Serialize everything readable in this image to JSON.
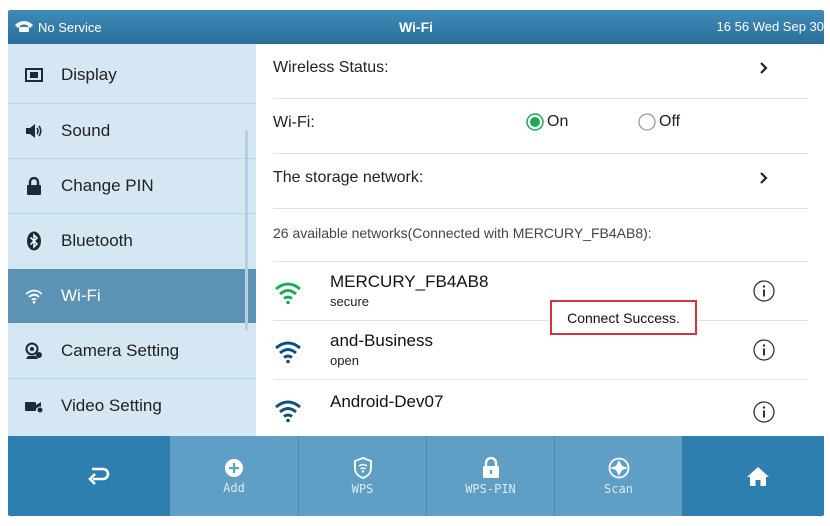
{
  "status_bar": {
    "signal_text": "No Service",
    "title": "Wi-Fi",
    "datetime": "16 56 Wed Sep 30"
  },
  "sidebar": {
    "items": [
      {
        "label": "Display",
        "icon": "display-icon"
      },
      {
        "label": "Sound",
        "icon": "speaker-icon"
      },
      {
        "label": "Change PIN",
        "icon": "lock-icon"
      },
      {
        "label": "Bluetooth",
        "icon": "bluetooth-icon"
      },
      {
        "label": "Wi-Fi",
        "icon": "wifi-icon",
        "active": true
      },
      {
        "label": "Camera Setting",
        "icon": "camera-icon"
      },
      {
        "label": "Video Setting",
        "icon": "video-icon"
      }
    ]
  },
  "main": {
    "wireless_status_label": "Wireless Status:",
    "wifi_label": "Wi-Fi:",
    "wifi_on_label": "On",
    "wifi_off_label": "Off",
    "wifi_selected": "On",
    "storage_network_label": "The storage network:",
    "networks_summary": "26 available networks(Connected with MERCURY_FB4AB8):",
    "connect_status": "Connect Success.",
    "networks": [
      {
        "name": "MERCURY_FB4AB8",
        "security": "secure",
        "color": "#1faa59"
      },
      {
        "name": "and-Business",
        "security": "open",
        "color": "#0d4f7c"
      },
      {
        "name": "Android-Dev07",
        "security": "",
        "color": "#0d4f7c"
      }
    ]
  },
  "bottom_bar": {
    "back_icon": "back-arrow-icon",
    "add_label": "Add",
    "wps_label": "WPS",
    "wps_pin_label": "WPS-PIN",
    "scan_label": "Scan",
    "home_icon": "home-icon"
  },
  "colors": {
    "status_bar": "#2b6f9b",
    "sidebar_bg": "#d4e7f2",
    "sidebar_active": "#5c93b5",
    "bottom_bar": "#2c7fae",
    "bottom_center": "#5f9fc6",
    "wifi_connected": "#1faa59",
    "highlight_border": "#d0343d"
  }
}
